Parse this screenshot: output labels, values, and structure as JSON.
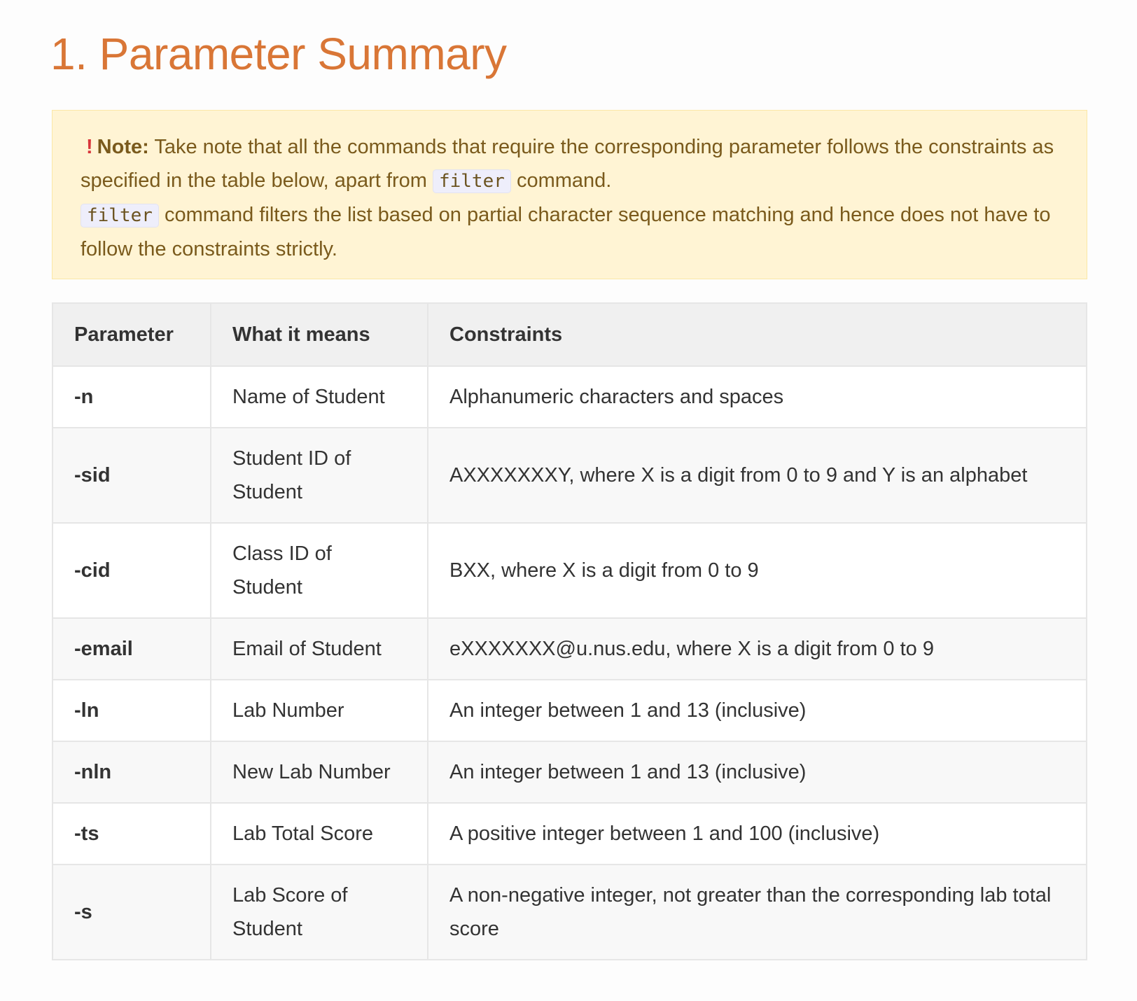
{
  "title": "1. Parameter Summary",
  "note": {
    "icon": "exclamation-icon",
    "label": "Note:",
    "text1": " Take note that all the commands that require the corresponding parameter follows the constraints as specified in the table below, apart from ",
    "code1": "filter",
    "text2": " command.",
    "code2": "filter",
    "text3": " command filters the list based on partial character sequence matching and hence does not have to follow the constraints strictly."
  },
  "table": {
    "headers": [
      "Parameter",
      "What it means",
      "Constraints"
    ],
    "rows": [
      [
        "-n",
        "Name of Student",
        "Alphanumeric characters and spaces"
      ],
      [
        "-sid",
        "Student ID of Student",
        "AXXXXXXXY, where X is a digit from 0 to 9 and Y is an alphabet"
      ],
      [
        "-cid",
        "Class ID of Student",
        "BXX, where X is a digit from 0 to 9"
      ],
      [
        "-email",
        "Email of Student",
        "eXXXXXXX@u.nus.edu, where X is a digit from 0 to 9"
      ],
      [
        "-ln",
        "Lab Number",
        "An integer between 1 and 13 (inclusive)"
      ],
      [
        "-nln",
        "New Lab Number",
        "An integer between 1 and 13 (inclusive)"
      ],
      [
        "-ts",
        "Lab Total Score",
        "A positive integer between 1 and 100 (inclusive)"
      ],
      [
        "-s",
        "Lab Score of Student",
        "A non-negative integer, not greater than the corresponding lab total score"
      ]
    ]
  },
  "colors": {
    "title": "#d97636",
    "note_bg": "#fff4d4",
    "note_text": "#7a5a1c"
  }
}
